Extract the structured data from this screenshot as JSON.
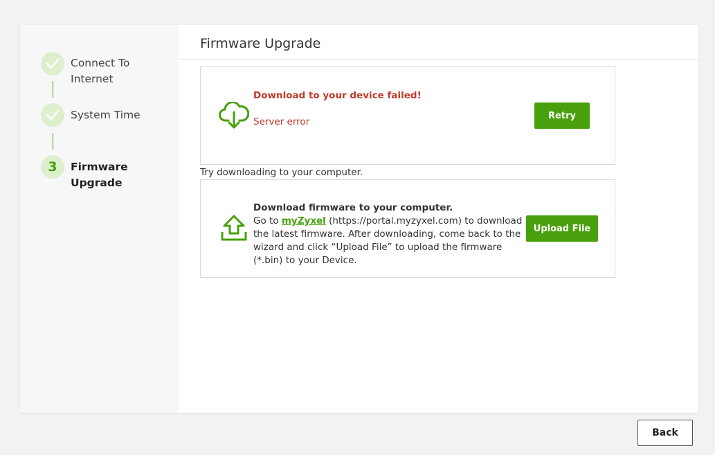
{
  "steps": [
    {
      "label_line1": "Connect To",
      "label_line2": "Internet",
      "status": "done"
    },
    {
      "label": "System Time",
      "status": "done"
    },
    {
      "number": "3",
      "label_line1": "Firmware",
      "label_line2": "Upgrade",
      "status": "active"
    }
  ],
  "main": {
    "title": "Firmware Upgrade"
  },
  "error_box": {
    "title": "Download to your device failed!",
    "message": "Server error",
    "icon": "cloud-download-icon",
    "retry_label": "Retry"
  },
  "hint": "Try downloading to your computer.",
  "download_box": {
    "title": "Download firmware to your computer.",
    "text_prefix": "Go to ",
    "link_text": "myZyxel",
    "text_suffix": " (https://portal.myzyxel.com) to download the latest firmware. After downloading, come back to the wizard and click “Upload File” to upload the firmware (*.bin) to your Device.",
    "icon": "upload-icon",
    "upload_label": "Upload File"
  },
  "footer": {
    "back_label": "Back"
  },
  "colors": {
    "accent": "#47a00c",
    "error": "#c0392b",
    "step_circle": "#deefce"
  }
}
